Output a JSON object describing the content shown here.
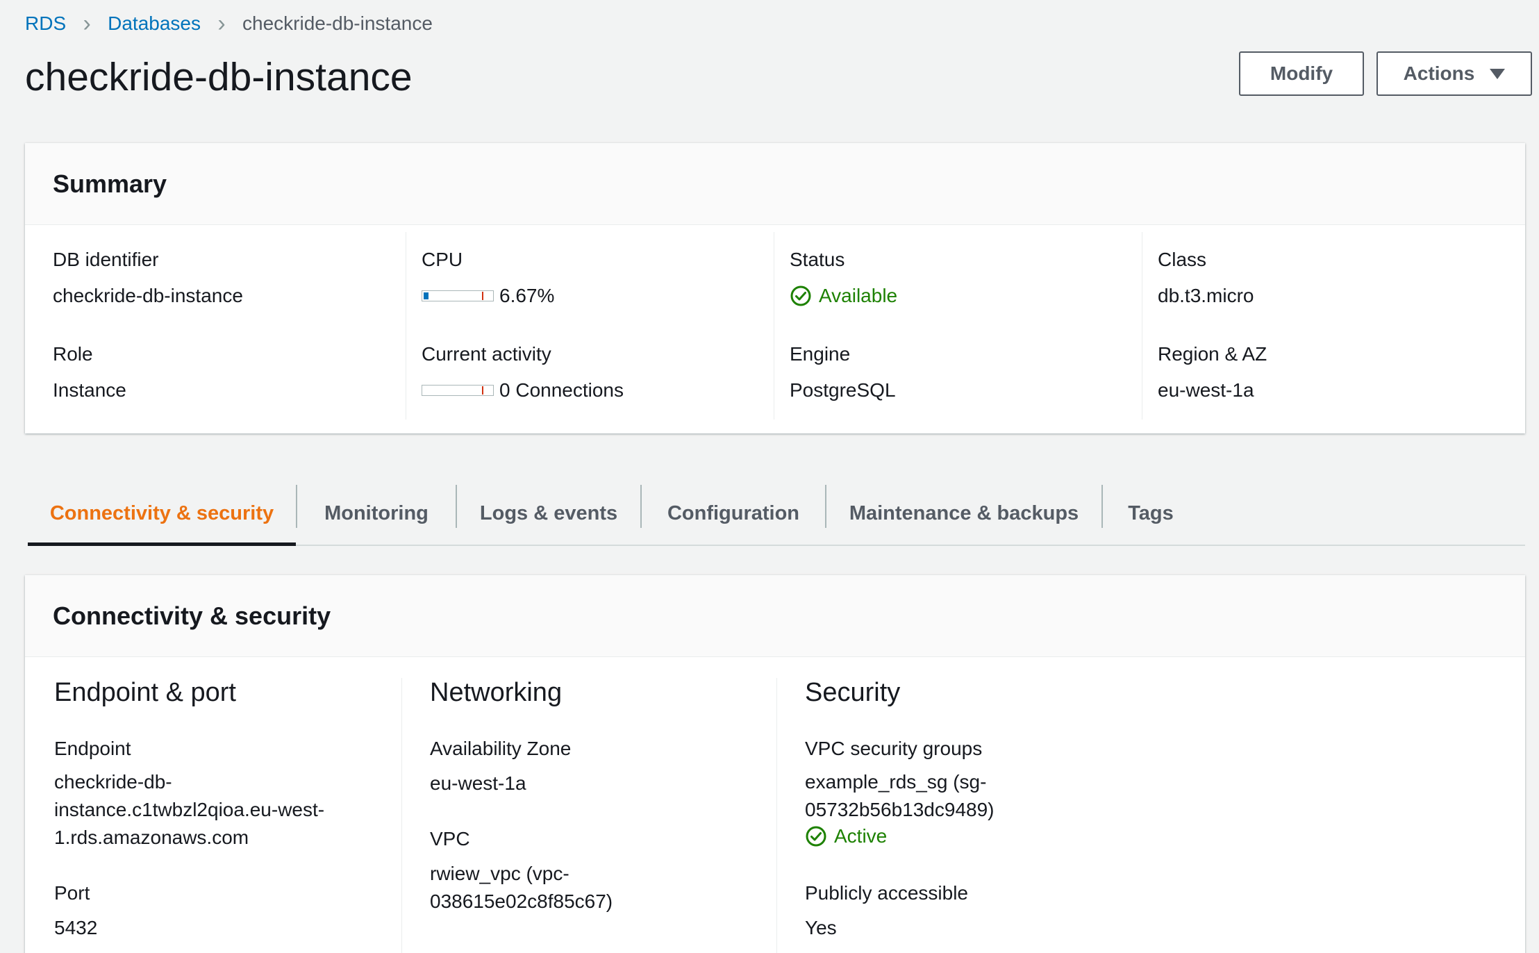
{
  "breadcrumb": {
    "rds": "RDS",
    "databases": "Databases",
    "current": "checkride-db-instance"
  },
  "page_title": "checkride-db-instance",
  "buttons": {
    "modify": "Modify",
    "actions": "Actions"
  },
  "summary": {
    "title": "Summary",
    "db_identifier_label": "DB identifier",
    "db_identifier_value": "checkride-db-instance",
    "role_label": "Role",
    "role_value": "Instance",
    "cpu_label": "CPU",
    "cpu_value": "6.67%",
    "cpu_fraction": 0.0667,
    "activity_label": "Current activity",
    "activity_value": "0 Connections",
    "activity_fraction": 0,
    "status_label": "Status",
    "status_value": "Available",
    "engine_label": "Engine",
    "engine_value": "PostgreSQL",
    "class_label": "Class",
    "class_value": "db.t3.micro",
    "region_label": "Region & AZ",
    "region_value": "eu-west-1a"
  },
  "tabs": [
    {
      "label": "Connectivity & security",
      "active": true
    },
    {
      "label": "Monitoring",
      "active": false
    },
    {
      "label": "Logs & events",
      "active": false
    },
    {
      "label": "Configuration",
      "active": false
    },
    {
      "label": "Maintenance & backups",
      "active": false
    },
    {
      "label": "Tags",
      "active": false
    }
  ],
  "connectivity": {
    "title": "Connectivity & security",
    "endpoint_section": "Endpoint & port",
    "endpoint_label": "Endpoint",
    "endpoint_lines": [
      "checkride-db-",
      "instance.c1twbzl2qioa.eu-west-",
      "1.rds.amazonaws.com"
    ],
    "port_label": "Port",
    "port_value": "5432",
    "networking_section": "Networking",
    "az_label": "Availability Zone",
    "az_value": "eu-west-1a",
    "vpc_label": "VPC",
    "vpc_lines": [
      "rwiew_vpc (vpc-",
      "038615e02c8f85c67)"
    ],
    "security_section": "Security",
    "sg_label": "VPC security groups",
    "sg_lines": [
      "example_rds_sg (sg-",
      "05732b56b13dc9489)"
    ],
    "sg_status": "Active",
    "public_label": "Publicly accessible",
    "public_value": "Yes"
  },
  "colors": {
    "link": "#0073bb",
    "active_tab": "#ec7211",
    "success": "#1d8102",
    "meter_fill": "#0073bb",
    "meter_mark": "#d13212"
  },
  "icons": [
    "check-circle-icon",
    "caret-down-icon",
    "chevron-right-icon"
  ]
}
